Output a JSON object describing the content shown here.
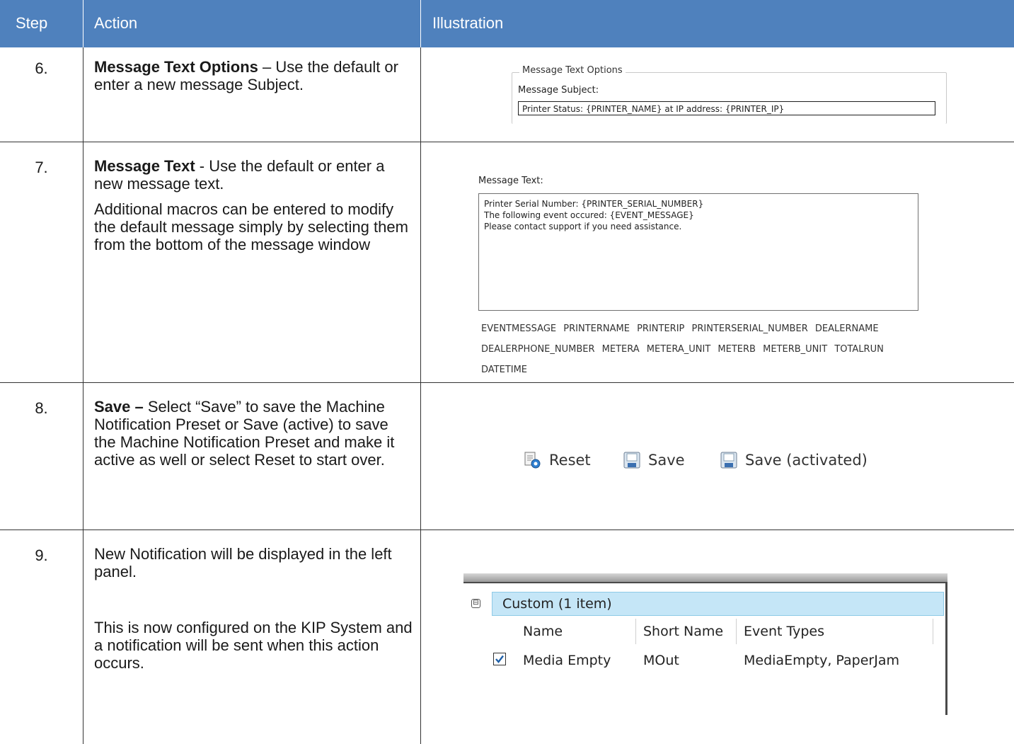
{
  "header": {
    "step": "Step",
    "action": "Action",
    "illustration": "Illustration"
  },
  "rows": [
    {
      "step": "6.",
      "action_bold": "Message Text Options",
      "action_rest": " – Use the default or enter a new message Subject.",
      "illustration": {
        "group_title": "Message Text Options",
        "subject_label": "Message Subject:",
        "subject_value": "Printer Status: {PRINTER_NAME} at IP address: {PRINTER_IP}"
      }
    },
    {
      "step": "7.",
      "action_bold": "Message Text",
      "action_rest": " - Use the default or enter a new message text.",
      "action_para2": "Additional macros can be entered to modify the default message simply by selecting them from the bottom of the message window",
      "illustration": {
        "text_label": "Message Text:",
        "text_lines": [
          "Printer Serial Number: {PRINTER_SERIAL_NUMBER}",
          "The following event occured: {EVENT_MESSAGE}",
          "Please contact support if you need assistance."
        ],
        "macros": [
          "EVENTMESSAGE",
          "PRINTERNAME",
          "PRINTERIP",
          "PRINTERSERIAL_NUMBER",
          "DEALERNAME",
          "DEALERPHONE_NUMBER",
          "METERA",
          "METERA_UNIT",
          "METERB",
          "METERB_UNIT",
          "TOTALRUN",
          "DATETIME"
        ]
      }
    },
    {
      "step": "8.",
      "action_bold": "Save –",
      "action_rest": " Select “Save” to save the Machine Notification Preset or Save (active) to save the Machine Notification Preset and make it active as well or select Reset to start over.",
      "illustration": {
        "buttons": [
          "Reset",
          "Save",
          "Save (activated)"
        ],
        "icons": [
          "reset-icon",
          "save-icon",
          "save-activated-icon"
        ]
      }
    },
    {
      "step": "9.",
      "action_para1": "New Notification will be displayed in the left panel.",
      "action_para2": "This is now configured on the KIP System and a notification will be sent when this action occurs.",
      "illustration": {
        "group_toggle": "⊟",
        "group_label": "Custom (1 item)",
        "columns": [
          "Name",
          "Short Name",
          "Event Types"
        ],
        "row": {
          "checked": true,
          "name": "Media Empty",
          "short_name": "MOut",
          "event_types": "MediaEmpty, PaperJam"
        }
      }
    }
  ],
  "colors": {
    "header_bg": "#4f81bd",
    "group_bg": "#c5e6f7",
    "check": "#1e5fa8"
  }
}
